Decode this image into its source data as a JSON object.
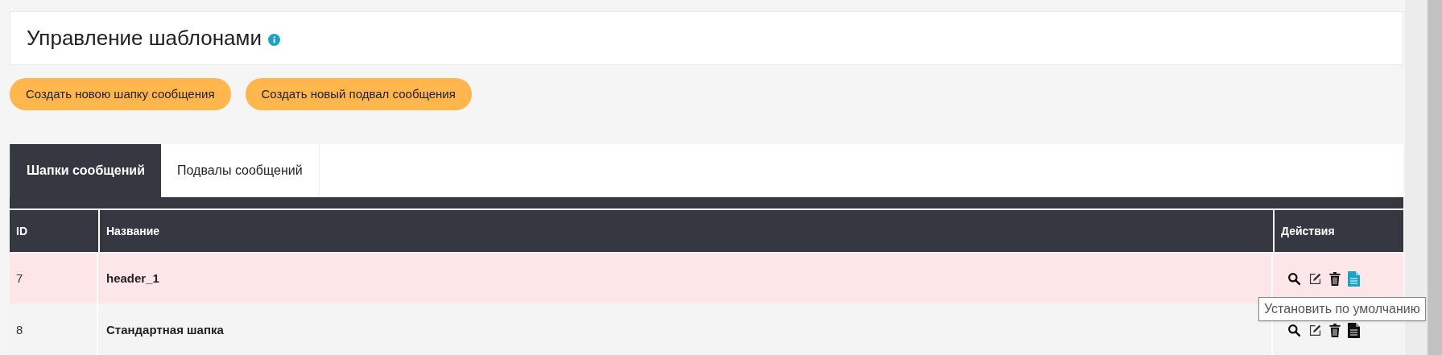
{
  "header": {
    "title": "Управление шаблонами"
  },
  "buttons": [
    "Создать новою шапку сообщения",
    "Создать новый подвал сообщения"
  ],
  "tabs": [
    {
      "label": "Шапки сообщений",
      "selected": true
    },
    {
      "label": "Подвалы сообщений",
      "selected": false
    }
  ],
  "table": {
    "columns": [
      "ID",
      "Название",
      "Действия"
    ],
    "rows": [
      {
        "id": "7",
        "name": "header_1",
        "is_default": true
      },
      {
        "id": "8",
        "name": "Стандартная шапка",
        "is_default": false
      }
    ]
  },
  "tooltip": "Установить по умолчанию"
}
